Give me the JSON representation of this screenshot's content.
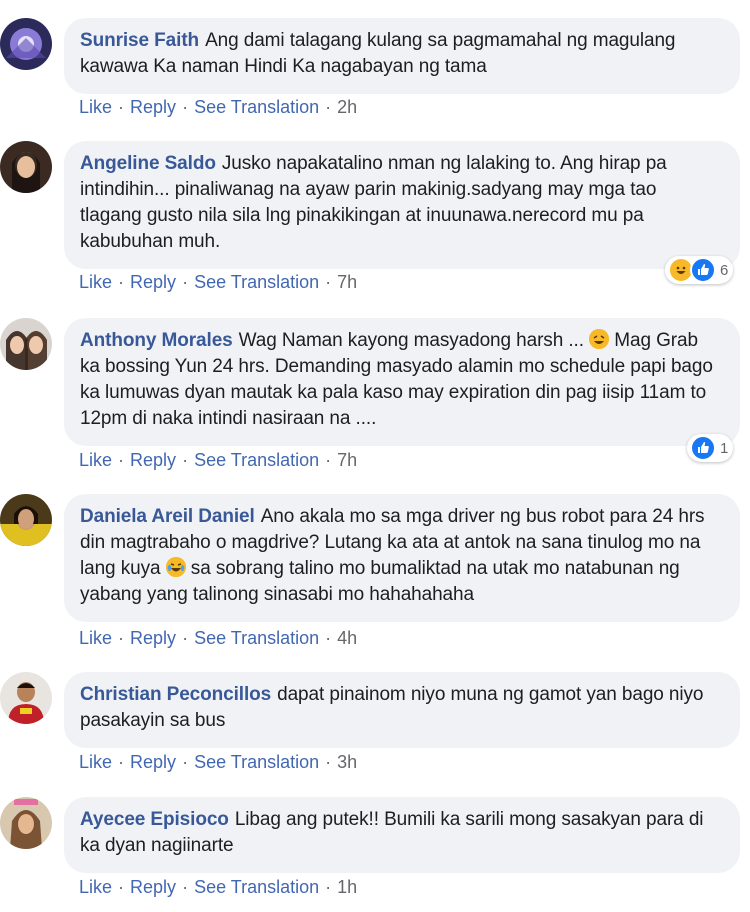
{
  "comments": [
    {
      "author": "Sunrise Faith",
      "text": "Ang dami talagang kulang sa pagmamahal ng magulang kawawa Ka naman Hindi Ka nagabayan ng tama",
      "actions": {
        "like": "Like",
        "reply": "Reply",
        "translate": "See Translation",
        "time": "2h"
      }
    },
    {
      "author": "Angeline Saldo",
      "text": "Jusko napakatalino nman ng lalaking to. Ang hirap pa intindihin... pinaliwanag na ayaw parin makinig.sadyang may mga tao tlagang gusto nila sila lng pinakikingan at inuunawa.nerecord mu pa kabubuhan muh.",
      "actions": {
        "like": "Like",
        "reply": "Reply",
        "translate": "See Translation",
        "time": "7h"
      },
      "reactions": {
        "types": [
          "haha-icon",
          "like-icon"
        ],
        "count": "6"
      }
    },
    {
      "author": "Anthony Morales",
      "text_before": "Wag Naman kayong masyadong harsh ... ",
      "emoji": "rofl-emoji",
      "text_after": " Mag Grab ka bossing Yun 24 hrs. Demanding masyado alamin mo schedule papi bago ka lumuwas dyan mautak ka pala kaso may expiration din pag iisip 11am to 12pm di naka intindi nasiraan na ....",
      "actions": {
        "like": "Like",
        "reply": "Reply",
        "translate": "See Translation",
        "time": "7h"
      },
      "reactions": {
        "types": [
          "like-icon"
        ],
        "count": "1"
      }
    },
    {
      "author": "Daniela Areil Daniel",
      "text_before": "Ano akala mo sa mga driver ng bus robot para 24 hrs din magtrabaho o magdrive? Lutang ka ata at antok na sana tinulog mo na lang kuya ",
      "emoji": "crying-laughing-emoji",
      "text_after": " sa sobrang talino mo bumaliktad na utak mo natabunan ng yabang yang talinong sinasabi mo hahahahaha",
      "actions": {
        "like": "Like",
        "reply": "Reply",
        "translate": "See Translation",
        "time": "4h"
      }
    },
    {
      "author": "Christian Peconcillos",
      "text": "dapat pinainom niyo muna ng gamot yan bago niyo pasakayin sa bus",
      "actions": {
        "like": "Like",
        "reply": "Reply",
        "translate": "See Translation",
        "time": "3h"
      }
    },
    {
      "author": "Ayecee Episioco",
      "text": "Libag ang putek!! Bumili ka sarili mong sasakyan para di ka dyan nagiinarte",
      "actions": {
        "like": "Like",
        "reply": "Reply",
        "translate": "See Translation",
        "time": "1h"
      }
    }
  ],
  "colors": {
    "author": "#385898",
    "link": "#4267b2",
    "bubble": "#f0f2f5",
    "like_blue": "#1877f2",
    "haha_yellow": "#f7b928"
  }
}
